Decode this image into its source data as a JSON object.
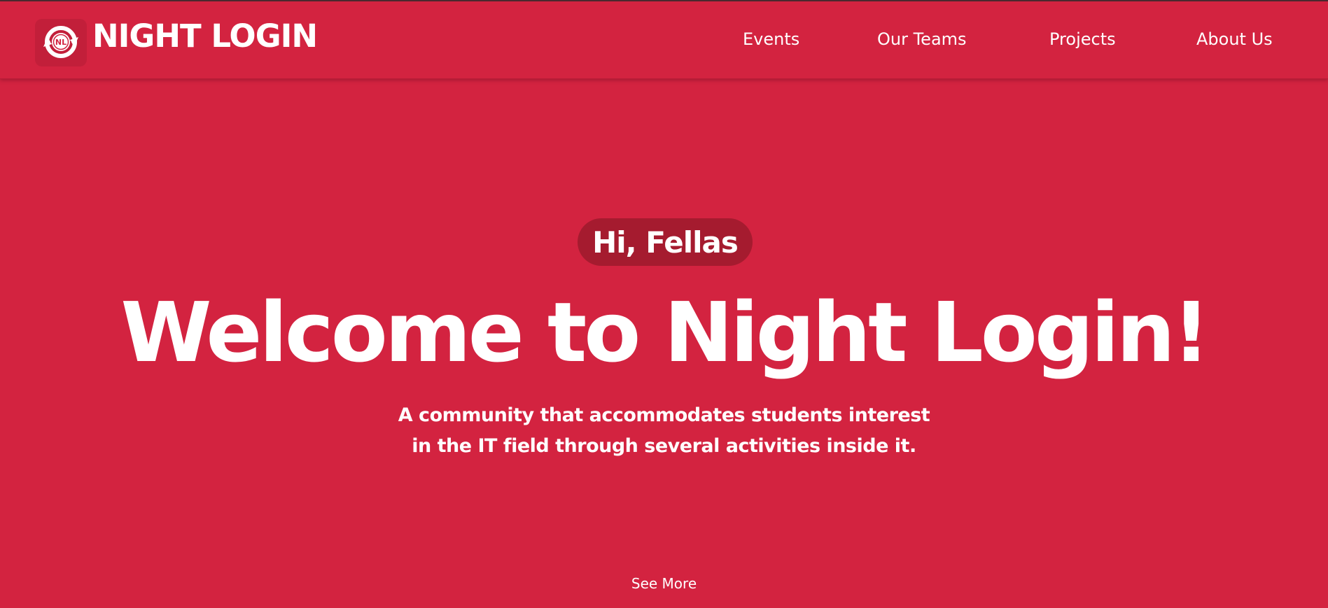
{
  "navbar": {
    "brand_name": "NIGHT LOGIN",
    "logo_text": "NL",
    "links": [
      {
        "label": "Events"
      },
      {
        "label": "Our Teams"
      },
      {
        "label": "Projects"
      },
      {
        "label": "About Us"
      }
    ]
  },
  "hero": {
    "greeting": "Hi, Fellas",
    "title": "Welcome to Night Login!",
    "subtitle_line1": "A community that accommodates students interest",
    "subtitle_line2": "in the IT field through several activities inside it.",
    "see_more": "See More"
  },
  "colors": {
    "background": "#d32340",
    "pill": "#a51b2f",
    "logo_box": "#c21f3a",
    "text": "#ffffff"
  },
  "icons": {
    "logo": "night-login-logo-icon"
  }
}
